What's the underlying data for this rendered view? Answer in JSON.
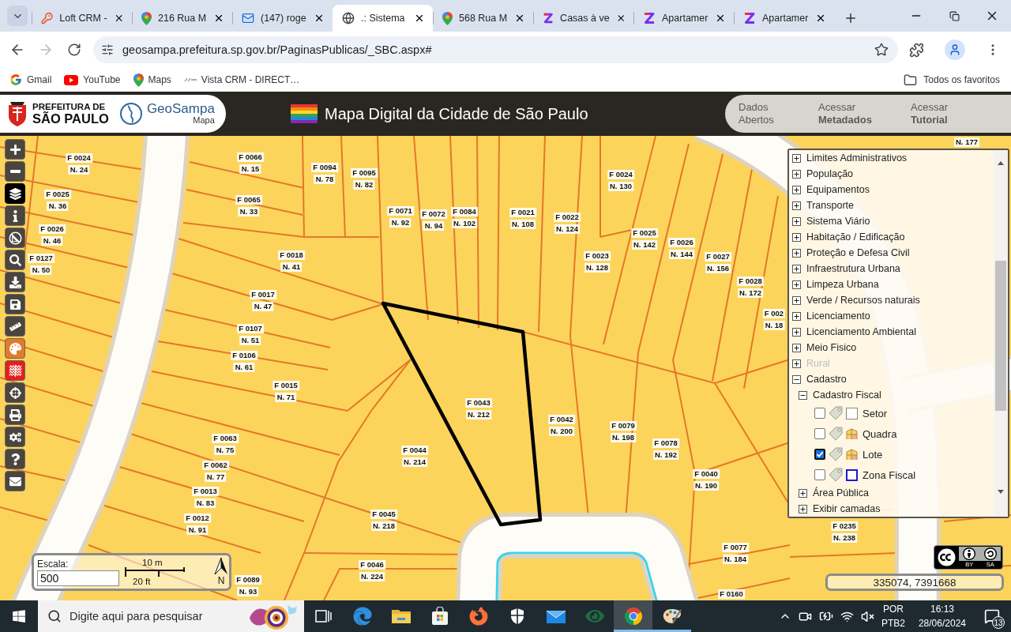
{
  "browser": {
    "tabs": [
      {
        "title": "Loft CRM -",
        "selected": false
      },
      {
        "title": "216 Rua M",
        "selected": false
      },
      {
        "title": "(147) roge",
        "selected": false
      },
      {
        "title": ".: Sistema",
        "selected": true
      },
      {
        "title": "568 Rua M",
        "selected": false
      },
      {
        "title": "Casas à ve",
        "selected": false
      },
      {
        "title": "Apartamer",
        "selected": false
      },
      {
        "title": "Apartamer",
        "selected": false
      }
    ],
    "nav": [
      {
        "kind": "back",
        "disabled": false
      },
      {
        "kind": "forward",
        "disabled": true
      },
      {
        "kind": "reload",
        "disabled": false
      }
    ],
    "address": {
      "url": "geosampa.prefeitura.sp.gov.br/PaginasPublicas/_SBC.aspx#"
    },
    "bookmarks": [
      {
        "label": "Gmail"
      },
      {
        "label": "YouTube"
      },
      {
        "label": "Maps"
      },
      {
        "label": "Vista CRM - DIRECT…"
      }
    ],
    "all_bookmarks": "Todos os favoritos"
  },
  "header": {
    "city_name": [
      "PREFEITURA DE",
      "SÃO PAULO"
    ],
    "app_logo": {
      "name": "GeoSampa",
      "subtitle": "Mapa"
    },
    "title": "Mapa Digital da Cidade de São Paulo",
    "links": [
      "Dados Abertos",
      "Acessar **Metadados**",
      "Acessar **Tutorial**"
    ]
  },
  "map": {
    "tools": [
      {
        "kind": "zoom-in",
        "selected": false
      },
      {
        "kind": "zoom-out",
        "selected": false
      },
      {
        "kind": "layers",
        "selected": true
      },
      {
        "kind": "info",
        "selected": false
      },
      {
        "kind": "measure-off",
        "selected": false
      },
      {
        "kind": "search",
        "selected": false
      },
      {
        "kind": "download",
        "selected": false
      },
      {
        "kind": "save",
        "selected": false
      },
      {
        "kind": "ruler",
        "selected": false
      },
      {
        "kind": "palette",
        "selected": false,
        "color": "#e17b2b"
      },
      {
        "kind": "contours",
        "selected": false,
        "color": "#e21f1d"
      },
      {
        "kind": "crosshair",
        "selected": false
      },
      {
        "kind": "print",
        "selected": false
      },
      {
        "kind": "settings",
        "selected": false
      },
      {
        "kind": "help",
        "selected": false
      },
      {
        "kind": "mail",
        "selected": false
      }
    ],
    "lots": [
      {
        "n": "N. 177"
      },
      {
        "f": "F 0024",
        "n": "N. 24"
      },
      {
        "f": "F 0066",
        "n": "N. 15"
      },
      {
        "f": "F 0094",
        "n": "N. 78"
      },
      {
        "f": "F 0095",
        "n": "N. 82"
      },
      {
        "f": "F 0024",
        "n": "N. 130"
      },
      {
        "f": "F 0025",
        "n": "N. 36"
      },
      {
        "f": "F 0065",
        "n": "N. 33"
      },
      {
        "f": "F 0071",
        "n": "N. 92"
      },
      {
        "f": "F 0072",
        "n": "N. 94"
      },
      {
        "f": "F 0084",
        "n": "N. 102"
      },
      {
        "f": "F 0021",
        "n": "N. 108"
      },
      {
        "f": "F 0022",
        "n": "N. 124"
      },
      {
        "f": "F 0026",
        "n": "N. 46"
      },
      {
        "f": "F 0025",
        "n": "N. 142"
      },
      {
        "f": "F 0026",
        "n": "N. 144"
      },
      {
        "f": "F 0127",
        "n": "N. 50"
      },
      {
        "f": "F 0018",
        "n": "N. 41"
      },
      {
        "f": "F 0023",
        "n": "N. 128"
      },
      {
        "f": "F 0027",
        "n": "N. 156"
      },
      {
        "f": "F 0028",
        "n": "N. 172"
      },
      {
        "f": "F 0017",
        "n": "N. 47"
      },
      {
        "f": "F 002",
        "n": "N. 18"
      },
      {
        "f": "F 0107",
        "n": "N. 51"
      },
      {
        "f": "F 0106",
        "n": "N. 61"
      },
      {
        "f": "F 0015",
        "n": "N. 71"
      },
      {
        "f": "F 0043",
        "n": "N. 212"
      },
      {
        "f": "F 0042",
        "n": "N. 200"
      },
      {
        "f": "F 0079",
        "n": "N. 198"
      },
      {
        "f": "F 0063",
        "n": "N. 75"
      },
      {
        "f": "F 0078",
        "n": "N. 192"
      },
      {
        "f": "F 0044",
        "n": "N. 214"
      },
      {
        "f": "F 0062",
        "n": "N. 77"
      },
      {
        "f": "F 0040",
        "n": "N. 190"
      },
      {
        "f": "F 0013",
        "n": "N. 83"
      },
      {
        "f": "F 0012",
        "n": "N. 91"
      },
      {
        "f": "F 0045",
        "n": "N. 218"
      },
      {
        "f": "F 0235",
        "n": "N. 238"
      },
      {
        "f": "F 0077",
        "n": "N. 184"
      },
      {
        "f": "F 0046",
        "n": "N. 224"
      },
      {
        "f": "F 0089",
        "n": "N. 93"
      },
      {
        "f": "F 0160"
      }
    ],
    "layers": [
      {
        "kind": "group",
        "label": "Limites Administrativos",
        "expanded": false,
        "disabled": false
      },
      {
        "kind": "group",
        "label": "População",
        "expanded": false,
        "disabled": false
      },
      {
        "kind": "group",
        "label": "Equipamentos",
        "expanded": false,
        "disabled": false
      },
      {
        "kind": "group",
        "label": "Transporte",
        "expanded": false,
        "disabled": false
      },
      {
        "kind": "group",
        "label": "Sistema Viário",
        "expanded": false,
        "disabled": false
      },
      {
        "kind": "group",
        "label": "Habitação / Edificação",
        "expanded": false,
        "disabled": false
      },
      {
        "kind": "group",
        "label": "Proteção e Defesa Civil",
        "expanded": false,
        "disabled": false
      },
      {
        "kind": "group",
        "label": "Infraestrutura Urbana",
        "expanded": false,
        "disabled": false
      },
      {
        "kind": "group",
        "label": "Limpeza Urbana",
        "expanded": false,
        "disabled": false
      },
      {
        "kind": "group",
        "label": "Verde / Recursos naturais",
        "expanded": false,
        "disabled": false
      },
      {
        "kind": "group",
        "label": "Licenciamento",
        "expanded": false,
        "disabled": false
      },
      {
        "kind": "group",
        "label": "Licenciamento Ambiental",
        "expanded": false,
        "disabled": false
      },
      {
        "kind": "group",
        "label": "Meio Fisico",
        "expanded": false,
        "disabled": false
      },
      {
        "kind": "group",
        "label": "Rural",
        "expanded": false,
        "disabled": true
      },
      {
        "kind": "group",
        "label": "Cadastro",
        "expanded": true,
        "disabled": false,
        "children": [
          {
            "kind": "group",
            "label": "Cadastro Fiscal",
            "expanded": true,
            "disabled": false,
            "children": [
              {
                "kind": "layer",
                "label": "Setor",
                "checked": false
              },
              {
                "kind": "layer",
                "label": "Quadra",
                "checked": false
              },
              {
                "kind": "layer",
                "label": "Lote",
                "checked": true
              },
              {
                "kind": "layer",
                "label": "Zona Fiscal",
                "checked": false
              }
            ]
          },
          {
            "kind": "group",
            "label": "Área Pública",
            "expanded": false,
            "disabled": false
          },
          {
            "kind": "group",
            "label": "Exibir camadas",
            "expanded": false,
            "disabled": false
          }
        ]
      }
    ],
    "scale": {
      "label": "Escala:",
      "value": "500",
      "metric": "10 m",
      "imperial": "20 ft",
      "north": "N"
    },
    "coordinates": "335074, 7391668",
    "license": [
      "BY",
      "SA"
    ]
  },
  "taskbar": {
    "search": {
      "placeholder": "Digite aqui para pesquisar"
    },
    "apps": [
      {
        "kind": "task-view",
        "open": false,
        "selected": false
      },
      {
        "kind": "edge",
        "open": false,
        "selected": false
      },
      {
        "kind": "explorer",
        "open": false,
        "selected": false
      },
      {
        "kind": "store",
        "open": false,
        "selected": false
      },
      {
        "kind": "firefox",
        "open": false,
        "selected": false
      },
      {
        "kind": "defender",
        "open": false,
        "selected": false
      },
      {
        "kind": "mail",
        "open": false,
        "selected": false
      },
      {
        "kind": "eye",
        "open": false,
        "selected": false
      },
      {
        "kind": "chrome",
        "open": true,
        "selected": true
      },
      {
        "kind": "paint",
        "open": true,
        "selected": false
      }
    ],
    "tray": {
      "language": "POR",
      "layout": "PTB2",
      "time": "16:13",
      "date": "28/06/2024",
      "notifications": "13"
    }
  }
}
